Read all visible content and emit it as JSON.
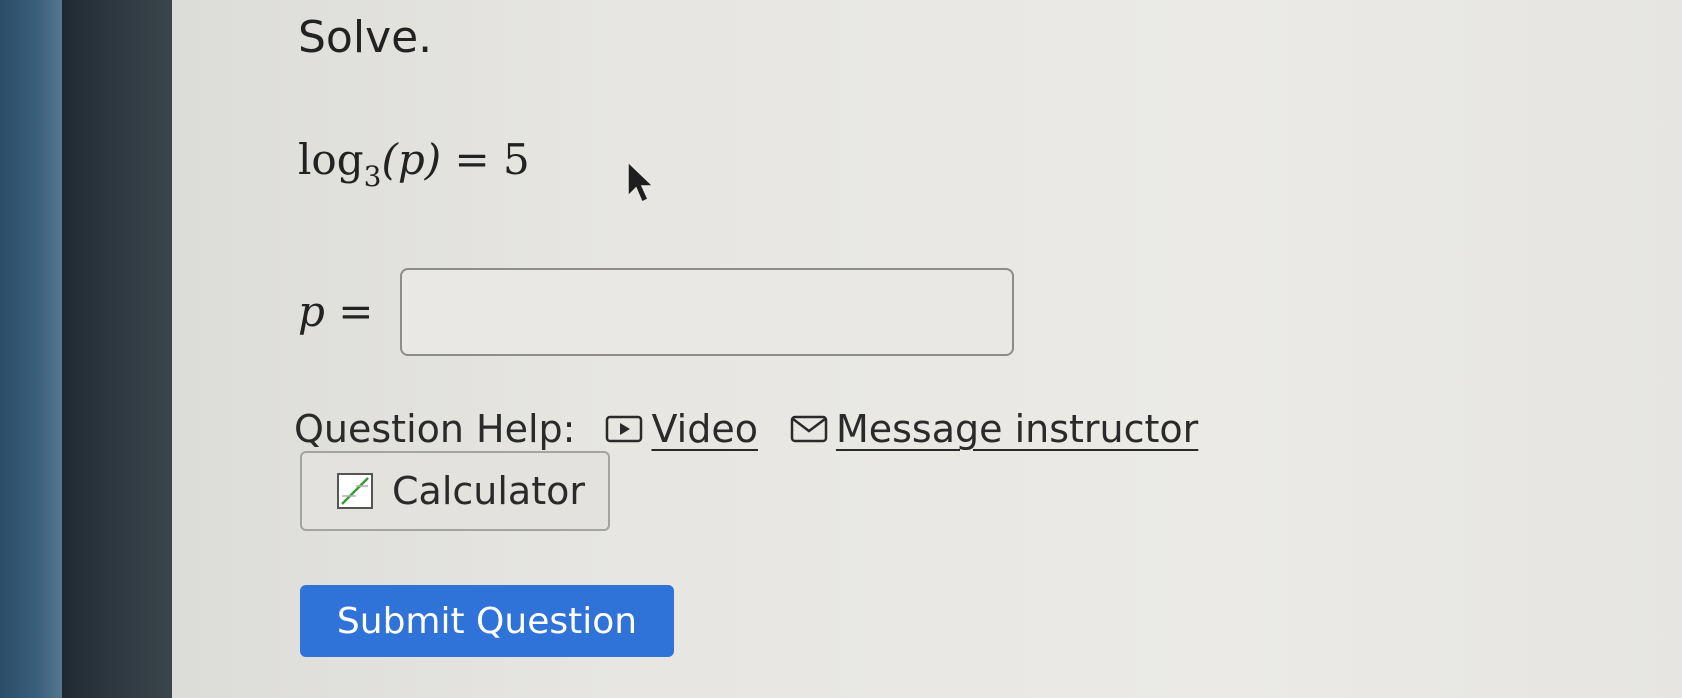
{
  "question": {
    "instruction": "Solve.",
    "equation": {
      "function": "log",
      "base": "3",
      "argument": "(p)",
      "rhs": "= 5"
    },
    "answer": {
      "variable": "p",
      "equals": "=",
      "value": "",
      "placeholder": ""
    }
  },
  "help": {
    "label": "Question Help:",
    "video_label": "Video",
    "message_label": "Message instructor"
  },
  "tools": {
    "calculator_label": "Calculator"
  },
  "actions": {
    "submit_label": "Submit Question"
  },
  "colors": {
    "submit_bg": "#2f72d8",
    "calculator_icon_accent": "#3a9a3a"
  },
  "icons": {
    "video": "video-play-icon",
    "message": "envelope-icon",
    "calculator": "calculator-icon",
    "cursor": "mouse-pointer-icon"
  }
}
